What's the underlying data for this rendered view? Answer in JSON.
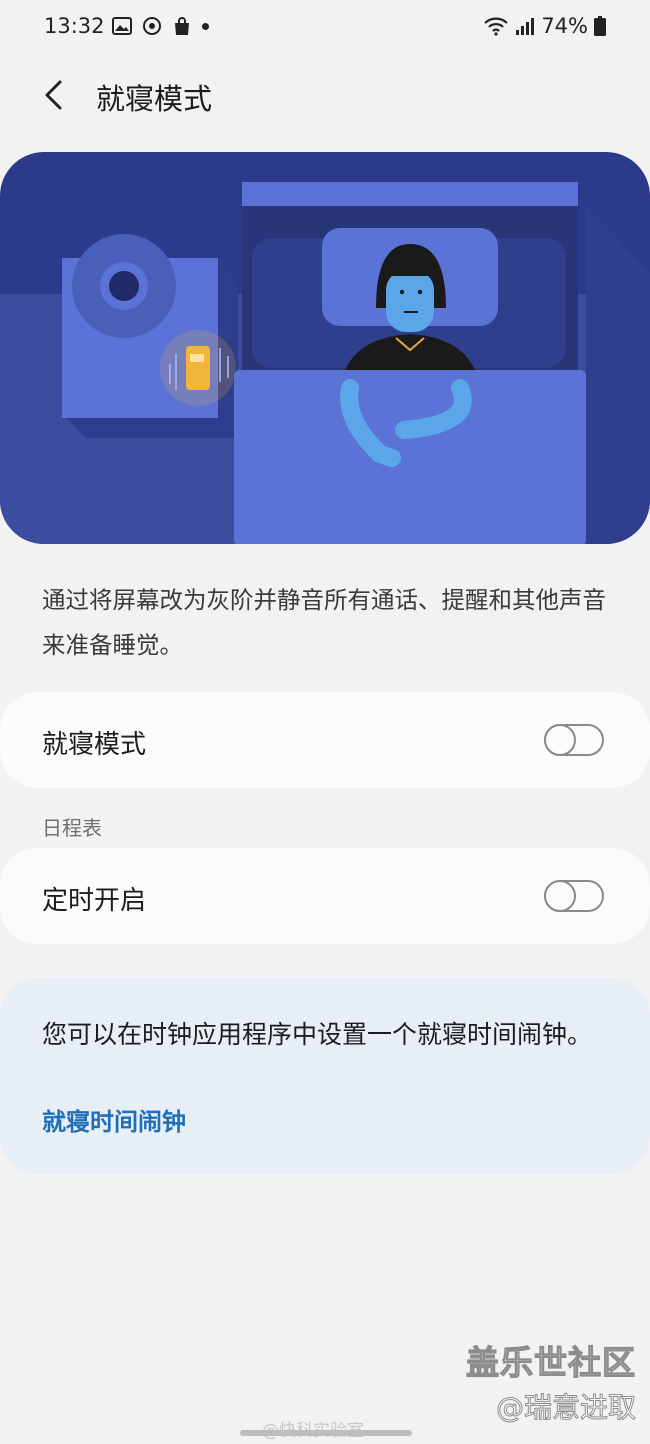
{
  "status_bar": {
    "time": "13:32",
    "battery": "74%",
    "left_icons": [
      "gallery-icon",
      "sync-icon",
      "shopping-bag-icon",
      "notification-dot-icon"
    ],
    "right_icons": [
      "wifi-icon",
      "signal-icon",
      "battery-icon"
    ]
  },
  "header": {
    "title": "就寝模式",
    "back_icon": "chevron-left-icon"
  },
  "description": "通过将屏幕改为灰阶并静音所有通话、提醒和其他声音来准备睡觉。",
  "bedtime_toggle": {
    "label": "就寝模式",
    "on": false
  },
  "schedule": {
    "section_label": "日程表",
    "label": "定时开启",
    "on": false
  },
  "info_card": {
    "text": "您可以在时钟应用程序中设置一个就寝时间闹钟。",
    "link": "就寝时间闹钟"
  },
  "watermarks": {
    "brand": "盖乐世社区",
    "author": "@瑞意进取",
    "weibo": "@快科实验室"
  },
  "colors": {
    "accent_link": "#1e6fb8",
    "hero_dark": "#2b3a8a",
    "hero_light": "#5b73d6",
    "phone_glow": "#f2b53a"
  }
}
